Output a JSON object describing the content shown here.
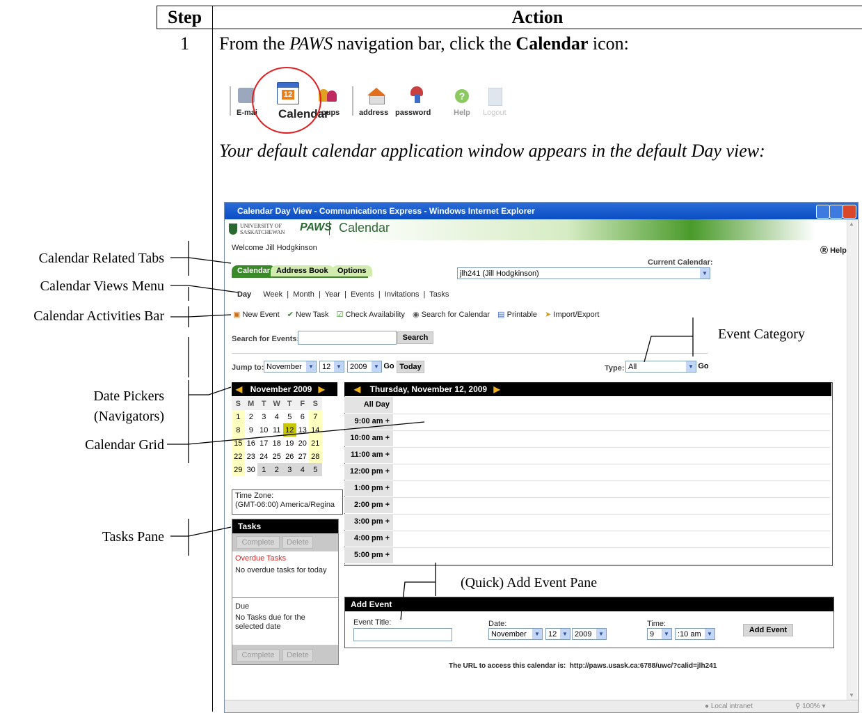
{
  "table": {
    "header_step": "Step",
    "header_action": "Action",
    "step_number": "1",
    "instruction": {
      "pre": "From the ",
      "nav_name": "PAWS",
      "mid": " navigation bar, click the ",
      "target": "Calendar",
      "post": " icon:"
    },
    "result_text": "Your default calendar application window appears in the default Day view:"
  },
  "navbar": {
    "items": [
      "E-mail",
      "Calendar",
      "Groups",
      "address",
      "password",
      "Help",
      "Logout"
    ],
    "visible_labels": {
      "email": "E-mai",
      "groups": "oups",
      "address": "address",
      "password": "password",
      "help": "Help",
      "logout": "Logout"
    },
    "calendar_day": "12"
  },
  "callouts": {
    "tabs": "Calendar Related Tabs",
    "views": "Calendar Views Menu",
    "activities": "Calendar Activities Bar",
    "date_pickers_1": "Date Pickers",
    "date_pickers_2": "(Navigators)",
    "grid": "Calendar Grid",
    "tasks": "Tasks Pane",
    "event_category": "Event Category",
    "quick_add": "(Quick) Add Event Pane"
  },
  "window": {
    "title": "Calendar Day View - Communications Express - Windows Internet Explorer",
    "university": "UNIVERSITY OF SASKATCHEWAN",
    "paws": "PAWS",
    "app_title": "Calendar",
    "welcome": "Welcome Jill Hodgkinson",
    "help": "Help",
    "tabs": [
      "Calendar",
      "Address Book",
      "Options"
    ],
    "current_calendar_label": "Current Calendar:",
    "current_calendar_value": "jlh241 (Jill Hodgkinson)",
    "views": [
      "Day",
      "Week",
      "Month",
      "Year",
      "Events",
      "Invitations",
      "Tasks"
    ],
    "activities": [
      "New Event",
      "New Task",
      "Check Availability",
      "Search for Calendar",
      "Printable",
      "Import/Export"
    ],
    "search_label": "Search for Events:",
    "search_button": "Search",
    "jump_label": "Jump to:",
    "jump_month": "November",
    "jump_day": "12",
    "jump_year": "2009",
    "go": "Go",
    "today": "Today",
    "type_label": "Type:",
    "type_value": "All",
    "mini_month_title": "November 2009",
    "weekdays": [
      "S",
      "M",
      "T",
      "W",
      "T",
      "F",
      "S"
    ],
    "mini_weeks": [
      [
        "1",
        "2",
        "3",
        "4",
        "5",
        "6",
        "7"
      ],
      [
        "8",
        "9",
        "10",
        "11",
        "12",
        "13",
        "14"
      ],
      [
        "15",
        "16",
        "17",
        "18",
        "19",
        "20",
        "21"
      ],
      [
        "22",
        "23",
        "24",
        "25",
        "26",
        "27",
        "28"
      ],
      [
        "29",
        "30",
        "1",
        "2",
        "3",
        "4",
        "5"
      ]
    ],
    "timezone_label": "Time Zone:",
    "timezone_value": "(GMT-06:00) America/Regina",
    "tasks_title": "Tasks",
    "complete": "Complete",
    "delete": "Delete",
    "overdue_title": "Overdue Tasks",
    "overdue_text": "No overdue tasks for today",
    "due_title": "Due",
    "due_text": "No Tasks due for the selected date",
    "day_header": "Thursday, November 12, 2009",
    "all_day": "All Day",
    "hours": [
      "9:00 am +",
      "10:00 am +",
      "11:00 am +",
      "12:00 pm +",
      "1:00 pm +",
      "2:00 pm +",
      "3:00 pm +",
      "4:00 pm +",
      "5:00 pm +"
    ],
    "add_event_title": "Add Event",
    "event_title_label": "Event Title:",
    "date_label": "Date:",
    "time_label": "Time:",
    "add_month": "November",
    "add_day": "12",
    "add_year": "2009",
    "add_hour": "9",
    "add_minute": ":10 am",
    "add_event_button": "Add Event",
    "url_label": "The URL to access this calendar is:",
    "url_value": "http://paws.usask.ca:6788/uwc/?calid=jlh241",
    "status_zone": "Local intranet",
    "status_zoom": "100%"
  }
}
